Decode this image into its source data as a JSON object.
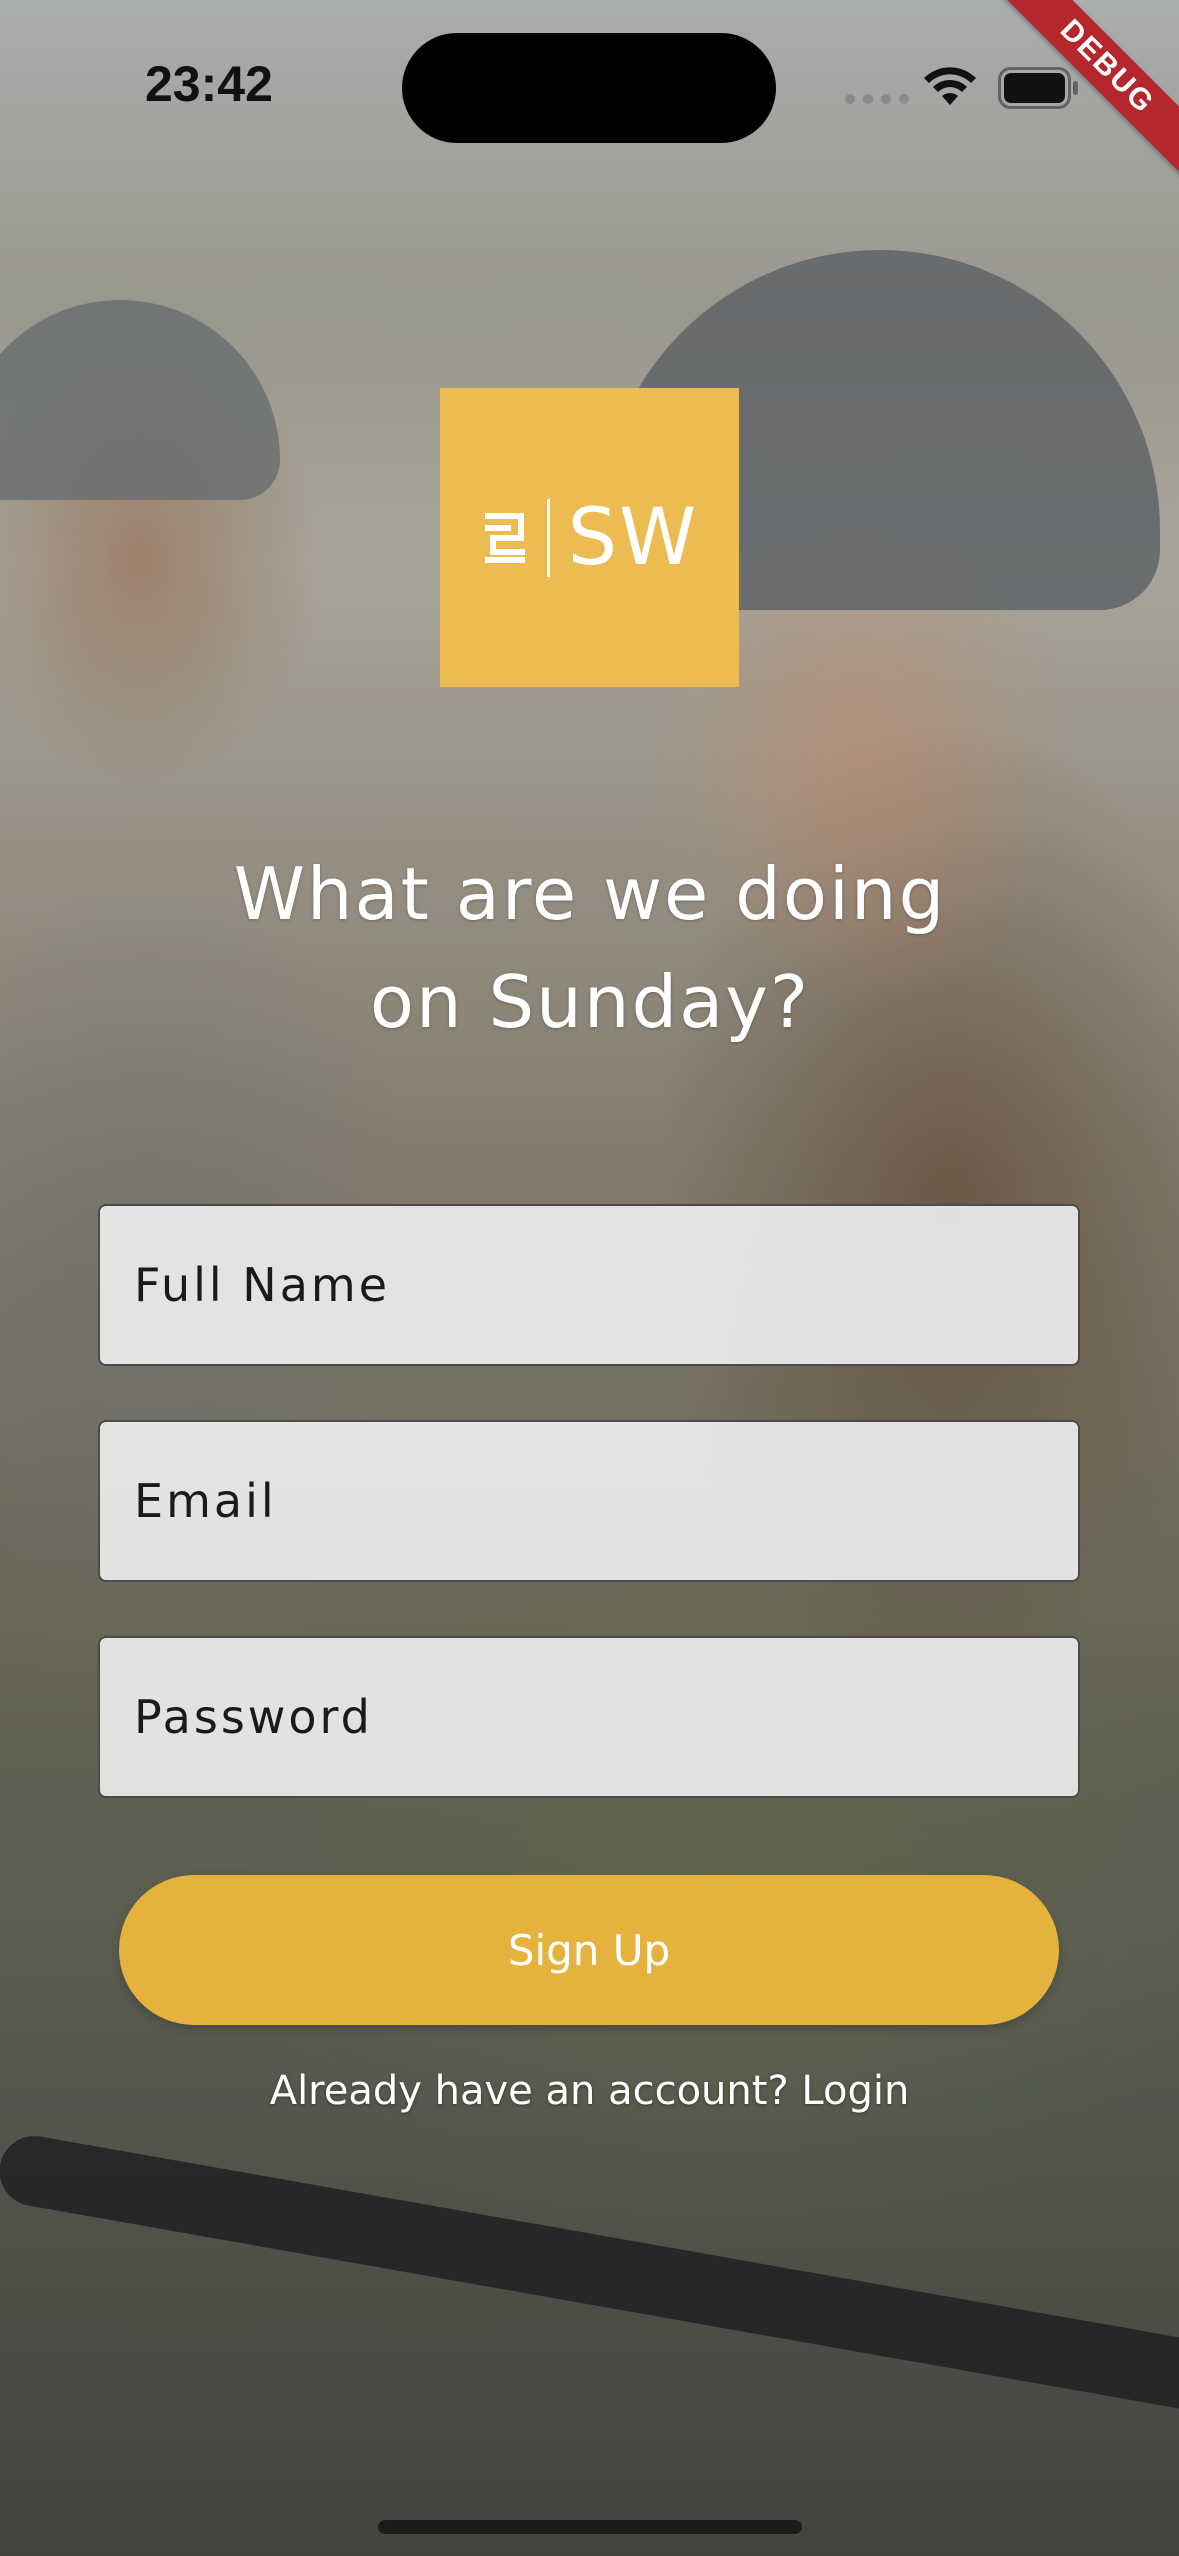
{
  "status_bar": {
    "time": "23:42"
  },
  "debug_banner": {
    "label": "DEBUG"
  },
  "logo": {
    "text": "SW"
  },
  "headline": {
    "line1": "What are we doing",
    "line2": "on Sunday?"
  },
  "form": {
    "full_name": {
      "placeholder": "Full Name",
      "value": ""
    },
    "email": {
      "placeholder": "Email",
      "value": ""
    },
    "password": {
      "placeholder": "Password",
      "value": ""
    }
  },
  "actions": {
    "signup_label": "Sign Up",
    "login_prompt": "Already have an account? Login"
  },
  "colors": {
    "accent": "#e6b23e",
    "logo_bg": "#ecbb52",
    "debug_banner": "#b5262d"
  },
  "icons": {
    "wifi": "wifi-icon",
    "battery": "battery-icon",
    "cellular": "cellular-signal-icon"
  }
}
